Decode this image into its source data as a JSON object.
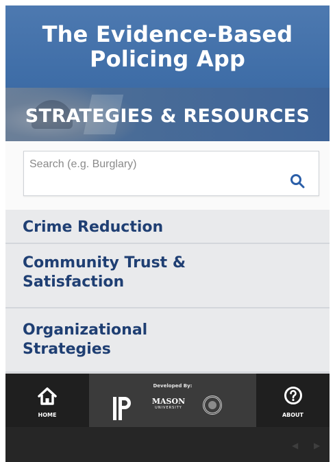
{
  "header": {
    "title_line1": "The Evidence-Based",
    "title_line2": "Policing App"
  },
  "banner": {
    "text": "STRATEGIES & RESOURCES"
  },
  "search": {
    "placeholder": "Search (e.g. Burglary)",
    "value": "",
    "icon": "search-icon"
  },
  "categories": [
    {
      "line1": "Crime Reduction"
    },
    {
      "line1": "Community Trust &",
      "line2": "Satisfaction"
    },
    {
      "line1": "Organizational",
      "line2": "Strategies"
    }
  ],
  "footer": {
    "home_label": "HOME",
    "home_icon": "home-icon",
    "developed_by": "Developed By:",
    "about_label": "ABOUT",
    "about_icon": "question-icon",
    "mason_logo_text": "MASON",
    "mason_logo_subtext": "UNIVERSITY"
  },
  "colors": {
    "header_blue": "#4d79b0",
    "text_navy": "#1f3f73",
    "footer_dark": "#1f1f1f"
  }
}
